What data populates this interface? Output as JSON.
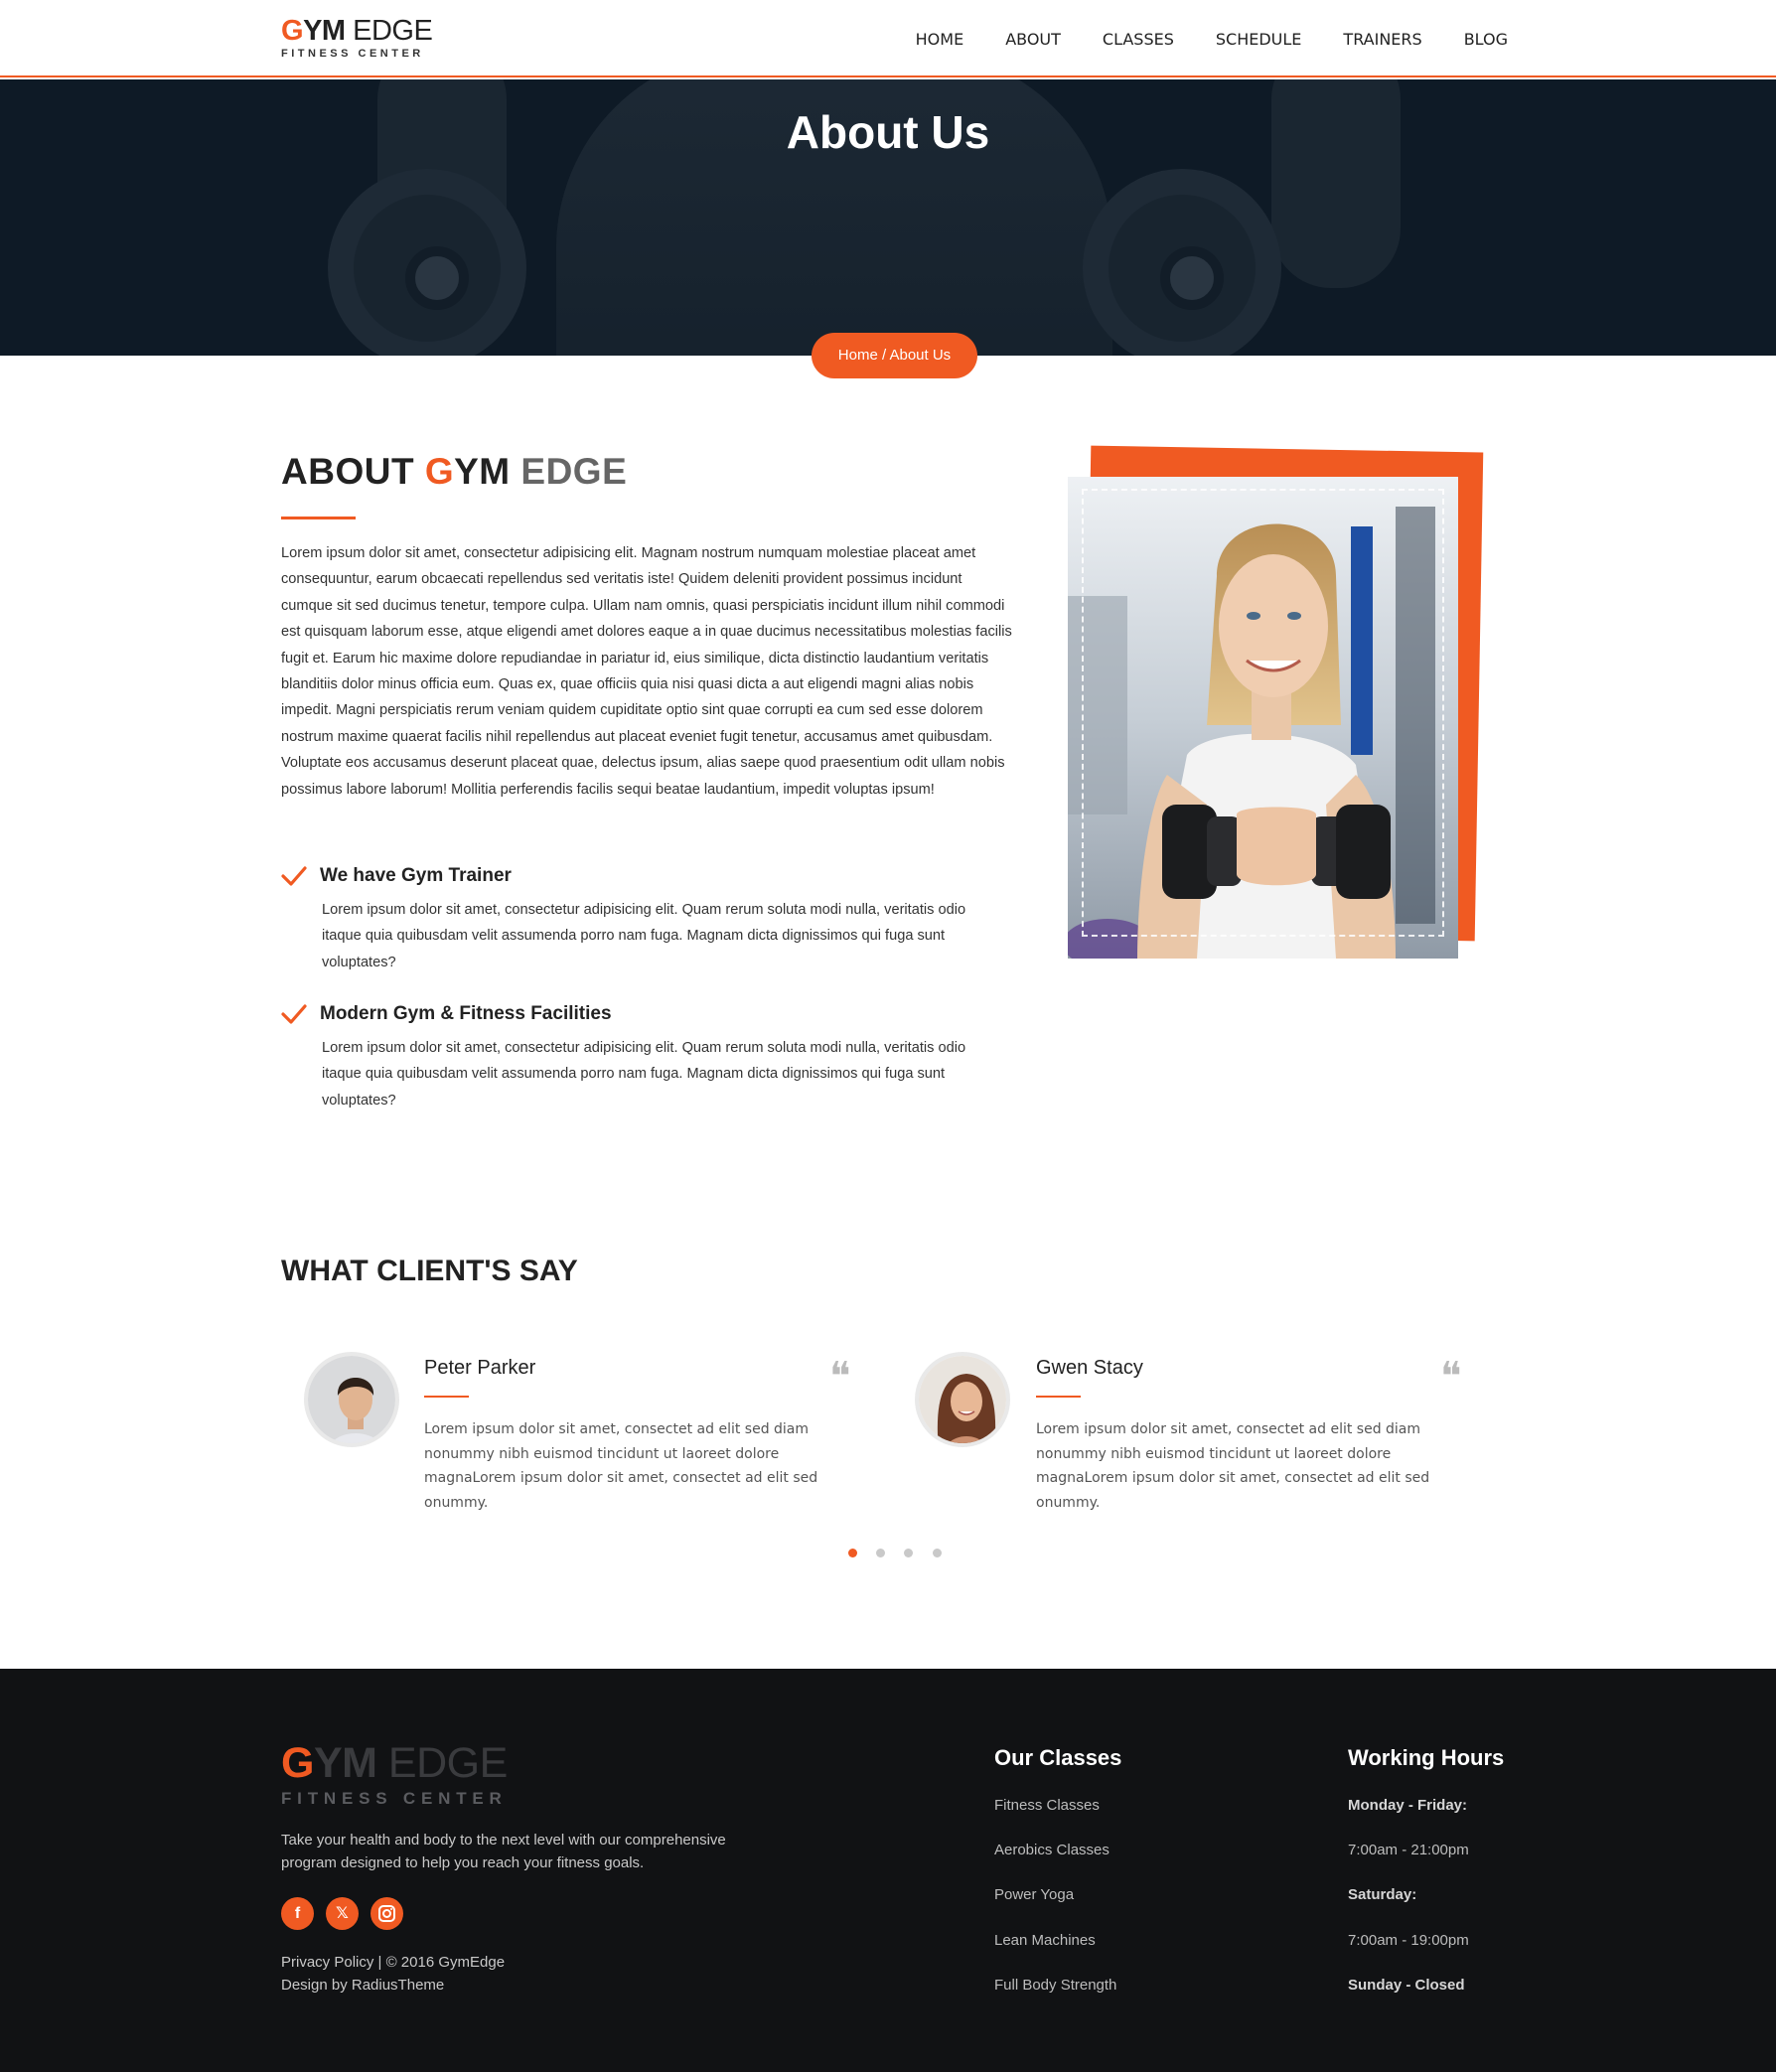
{
  "header": {
    "logo": {
      "gym_first": "G",
      "gym_rest": "YM",
      "edge": " EDGE",
      "tagline": "FITNESS CENTER"
    },
    "nav": [
      "HOME",
      "ABOUT",
      "CLASSES",
      "SCHEDULE",
      "TRAINERS",
      "BLOG"
    ]
  },
  "hero": {
    "title": "About Us",
    "breadcrumb": "Home / About Us"
  },
  "about": {
    "heading_part1": "ABOUT ",
    "heading_g": "G",
    "heading_ym": "YM ",
    "heading_edge": "EDGE",
    "paragraph": "Lorem ipsum dolor sit amet, consectetur adipisicing elit. Magnam nostrum numquam molestiae placeat amet consequuntur, earum obcaecati repellendus sed veritatis iste! Quidem deleniti provident possimus incidunt cumque sit sed ducimus tenetur, tempore culpa. Ullam nam omnis, quasi perspiciatis incidunt illum nihil commodi est quisquam laborum esse, atque eligendi amet dolores eaque a in quae ducimus necessitatibus molestias facilis fugit et. Earum hic maxime dolore repudiandae in pariatur id, eius similique, dicta distinctio laudantium veritatis blanditiis dolor minus officia eum. Quas ex, quae officiis quia nisi quasi dicta a aut eligendi magni alias nobis impedit. Magni perspiciatis rerum veniam quidem cupiditate optio sint quae corrupti ea cum sed esse dolorem nostrum maxime quaerat facilis nihil repellendus aut placeat eveniet fugit tenetur, accusamus amet quibusdam. Voluptate eos accusamus deserunt placeat quae, delectus ipsum, alias saepe quod praesentium odit ullam nobis possimus labore laborum! Mollitia perferendis facilis sequi beatae laudantium, impedit voluptas ipsum!",
    "features": [
      {
        "title": "We have Gym Trainer",
        "text": "Lorem ipsum dolor sit amet, consectetur adipisicing elit. Quam rerum soluta modi nulla, veritatis odio itaque quia quibusdam velit assumenda porro nam fuga. Magnam dicta dignissimos qui fuga sunt voluptates?"
      },
      {
        "title": "Modern Gym & Fitness Facilities",
        "text": "Lorem ipsum dolor sit amet, consectetur adipisicing elit. Quam rerum soluta modi nulla, veritatis odio itaque quia quibusdam velit assumenda porro nam fuga. Magnam dicta dignissimos qui fuga sunt voluptates?"
      }
    ]
  },
  "testimonials": {
    "heading": "WHAT CLIENT'S SAY",
    "items": [
      {
        "name": "Peter Parker",
        "text": "Lorem ipsum dolor sit amet, consectet ad elit sed diam nonummy nibh euismod tincidunt ut laoreet dolore magnaLorem ipsum dolor sit amet, consectet ad elit sed onummy."
      },
      {
        "name": "Gwen Stacy",
        "text": "Lorem ipsum dolor sit amet, consectet ad elit sed diam nonummy nibh euismod tincidunt ut laoreet dolore magnaLorem ipsum dolor sit amet, consectet ad elit sed onummy."
      }
    ],
    "dots": 4,
    "active_dot": 1
  },
  "footer": {
    "logo": {
      "gym_first": "G",
      "gym_rest": "YM",
      "edge": " EDGE",
      "tagline": "FITNESS CENTER"
    },
    "description": "Take your health and body to the next level with our comprehensive program designed to help you reach your fitness goals.",
    "social": [
      "facebook-icon",
      "x-twitter-icon",
      "instagram-icon"
    ],
    "copyright": "Privacy Policy | © 2016 GymEdge",
    "design_by": "Design by RadiusTheme",
    "classes_heading": "Our Classes",
    "classes": [
      "Fitness Classes",
      "Aerobics Classes",
      "Power Yoga",
      "Lean Machines",
      "Full Body Strength"
    ],
    "hours_heading": "Working Hours",
    "hours": [
      "Monday - Friday:",
      "7:00am - 21:00pm",
      "Saturday:",
      "7:00am - 19:00pm",
      "Sunday - Closed"
    ]
  },
  "colors": {
    "accent": "#f05a22",
    "dark": "#111214",
    "hero": "#0e1a26"
  }
}
